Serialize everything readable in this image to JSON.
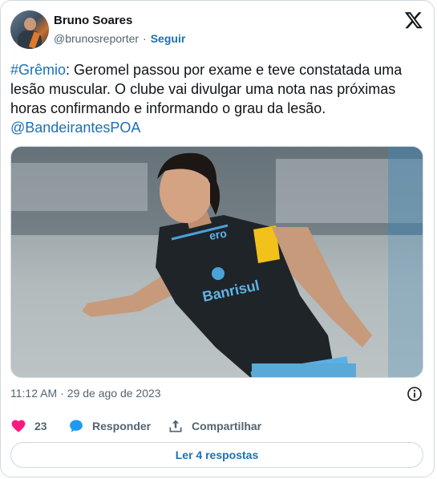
{
  "author": {
    "name": "Bruno Soares",
    "handle": "@brunosreporter",
    "separator": "·",
    "follow_label": "Seguir"
  },
  "tweet": {
    "hashtag": "#Grêmio",
    "body": ": Geromel passou por exame e teve constatada uma lesão muscular. O clube vai divulgar uma nota nas próximas horas confirmando e informando o grau da lesão. ",
    "mention": "@BandeirantesPOA"
  },
  "media": {
    "sponsor_text": "Banrisul",
    "chest_text": "ero"
  },
  "meta": {
    "time": "11:12 AM",
    "separator": "·",
    "date": "29 de ago de 2023"
  },
  "actions": {
    "likes_count": "23",
    "reply_label": "Responder",
    "share_label": "Compartilhar"
  },
  "read_replies_label": "Ler 4 respostas",
  "colors": {
    "link": "#1d6fb5",
    "like": "#f91880",
    "reply_icon": "#1d9bf0",
    "text": "#0f1419",
    "secondary": "#536471"
  },
  "icons": {
    "platform": "x-logo-icon",
    "info": "info-icon",
    "like": "heart-icon",
    "reply": "speech-bubble-icon",
    "share": "share-icon"
  }
}
